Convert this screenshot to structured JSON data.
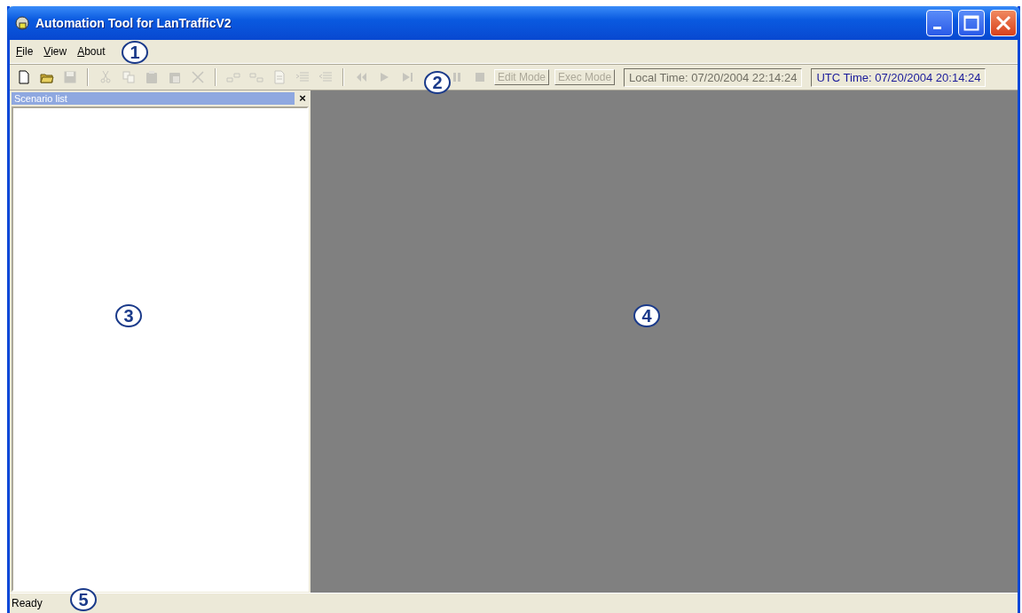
{
  "window": {
    "title": "Automation Tool for LanTrafficV2"
  },
  "menu": [
    {
      "label": "File"
    },
    {
      "label": "View"
    },
    {
      "label": "About"
    }
  ],
  "toolbar": {
    "icons": [
      {
        "disabled": false
      },
      {
        "disabled": false
      },
      {
        "disabled": true
      },
      {
        "disabled": true
      },
      {
        "disabled": true
      },
      {
        "disabled": true
      },
      {
        "disabled": true
      },
      {
        "disabled": true
      },
      {
        "disabled": true
      },
      {
        "disabled": true
      },
      {
        "disabled": true
      },
      {
        "disabled": true
      },
      {
        "disabled": true
      },
      {
        "disabled": true
      },
      {
        "disabled": true
      },
      {
        "disabled": true
      },
      {
        "disabled": true
      },
      {
        "disabled": true
      }
    ],
    "buttons": [
      {
        "label": "Edit Mode",
        "disabled": true
      },
      {
        "label": "Exec Mode",
        "disabled": true
      }
    ],
    "local_time": "Local Time: 07/20/2004 22:14:24",
    "utc_time": "UTC Time: 07/20/2004 20:14:24"
  },
  "scenario_panel": {
    "title": "Scenario list",
    "close": "×"
  },
  "status_bar": {
    "text": "Ready"
  },
  "callouts": [
    {
      "label": "1"
    },
    {
      "label": "2"
    },
    {
      "label": "3"
    },
    {
      "label": "4"
    },
    {
      "label": "5"
    }
  ]
}
